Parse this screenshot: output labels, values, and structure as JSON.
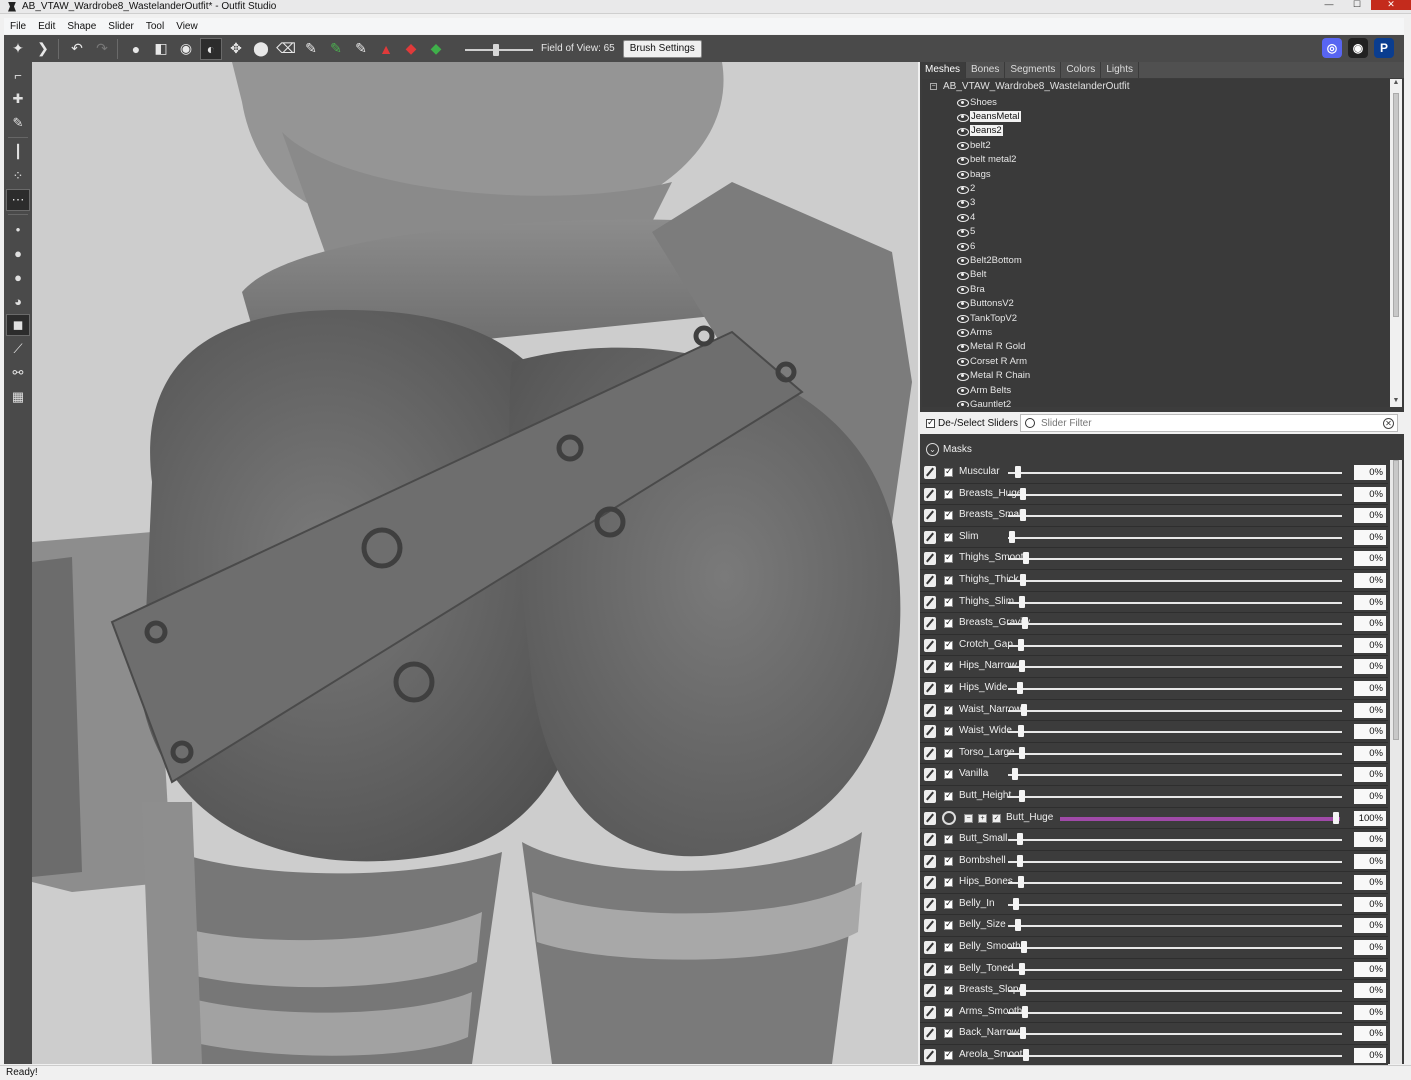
{
  "window": {
    "title": "AB_VTAW_Wardrobe8_WastelanderOutfit* - Outfit Studio",
    "controls": {
      "minimize": "—",
      "maximize": "☐",
      "close": "✕"
    }
  },
  "menu": [
    "File",
    "Edit",
    "Shape",
    "Slider",
    "Tool",
    "View"
  ],
  "toolbar": {
    "fov_label": "Field of View: 65",
    "fov_value": 65,
    "brush_settings_label": "Brush Settings"
  },
  "panel": {
    "tabs": [
      "Meshes",
      "Bones",
      "Segments",
      "Colors",
      "Lights"
    ],
    "active_tab": "Meshes",
    "root_mesh": "AB_VTAW_Wardrobe8_WastelanderOutfit",
    "meshes": [
      {
        "name": "Shoes",
        "selected": false
      },
      {
        "name": "JeansMetal",
        "selected": true
      },
      {
        "name": "Jeans2",
        "selected": true
      },
      {
        "name": "belt2",
        "selected": false
      },
      {
        "name": "belt metal2",
        "selected": false
      },
      {
        "name": "bags",
        "selected": false
      },
      {
        "name": "2",
        "selected": false
      },
      {
        "name": "3",
        "selected": false
      },
      {
        "name": "4",
        "selected": false
      },
      {
        "name": "5",
        "selected": false
      },
      {
        "name": "6",
        "selected": false
      },
      {
        "name": "Belt2Bottom",
        "selected": false
      },
      {
        "name": "Belt",
        "selected": false
      },
      {
        "name": "Bra",
        "selected": false
      },
      {
        "name": "ButtonsV2",
        "selected": false
      },
      {
        "name": "TankTopV2",
        "selected": false
      },
      {
        "name": "Arms",
        "selected": false
      },
      {
        "name": "Metal R Gold",
        "selected": false
      },
      {
        "name": "Corset R Arm",
        "selected": false
      },
      {
        "name": "Metal R Chain",
        "selected": false
      },
      {
        "name": "Arm Belts",
        "selected": false
      },
      {
        "name": "Gauntlet2",
        "selected": false
      }
    ],
    "deselect_label": "De-/Select Sliders",
    "slider_filter_placeholder": "Slider Filter",
    "masks_label": "Masks",
    "sliders": [
      {
        "name": "Muscular",
        "value": "0%",
        "pos": 0.0
      },
      {
        "name": "Breasts_Huge",
        "value": "0%",
        "pos": 0.05
      },
      {
        "name": "Breasts_Small",
        "value": "0%",
        "pos": 0.05
      },
      {
        "name": "Slim",
        "value": "0%",
        "pos": -0.06
      },
      {
        "name": "Thighs_Smooth",
        "value": "0%",
        "pos": 0.08
      },
      {
        "name": "Thighs_Thick",
        "value": "0%",
        "pos": 0.05
      },
      {
        "name": "Thighs_Slim",
        "value": "0%",
        "pos": 0.04
      },
      {
        "name": "Breasts_Gravity",
        "value": "0%",
        "pos": 0.07
      },
      {
        "name": "Crotch_Gap",
        "value": "0%",
        "pos": 0.03
      },
      {
        "name": "Hips_Narrow",
        "value": "0%",
        "pos": 0.04
      },
      {
        "name": "Hips_Wide",
        "value": "0%",
        "pos": 0.02
      },
      {
        "name": "Waist_Narrow",
        "value": "0%",
        "pos": 0.06
      },
      {
        "name": "Waist_Wide",
        "value": "0%",
        "pos": 0.03
      },
      {
        "name": "Torso_Large",
        "value": "0%",
        "pos": 0.04
      },
      {
        "name": "Vanilla",
        "value": "0%",
        "pos": -0.03
      },
      {
        "name": "Butt_Height",
        "value": "0%",
        "pos": 0.04
      },
      {
        "name": "Butt_Huge",
        "value": "100%",
        "pos": 1.0,
        "selected": true
      },
      {
        "name": "Butt_Small",
        "value": "0%",
        "pos": 0.02
      },
      {
        "name": "Bombshell",
        "value": "0%",
        "pos": 0.02
      },
      {
        "name": "Hips_Bones",
        "value": "0%",
        "pos": 0.03
      },
      {
        "name": "Belly_In",
        "value": "0%",
        "pos": -0.02
      },
      {
        "name": "Belly_Size",
        "value": "0%",
        "pos": 0.0
      },
      {
        "name": "Belly_Smooth",
        "value": "0%",
        "pos": 0.06
      },
      {
        "name": "Belly_Toned",
        "value": "0%",
        "pos": 0.04
      },
      {
        "name": "Breasts_Slope",
        "value": "0%",
        "pos": 0.05
      },
      {
        "name": "Arms_Smooth",
        "value": "0%",
        "pos": 0.07
      },
      {
        "name": "Back_Narrow",
        "value": "0%",
        "pos": 0.05
      },
      {
        "name": "Areola_Smooth",
        "value": "0%",
        "pos": 0.08
      }
    ]
  },
  "status": "Ready!",
  "colors": {
    "selected_slider": "#a04aa8",
    "panel_bg": "#3c3c3c",
    "viewport_bg": "#cdcdcd"
  }
}
